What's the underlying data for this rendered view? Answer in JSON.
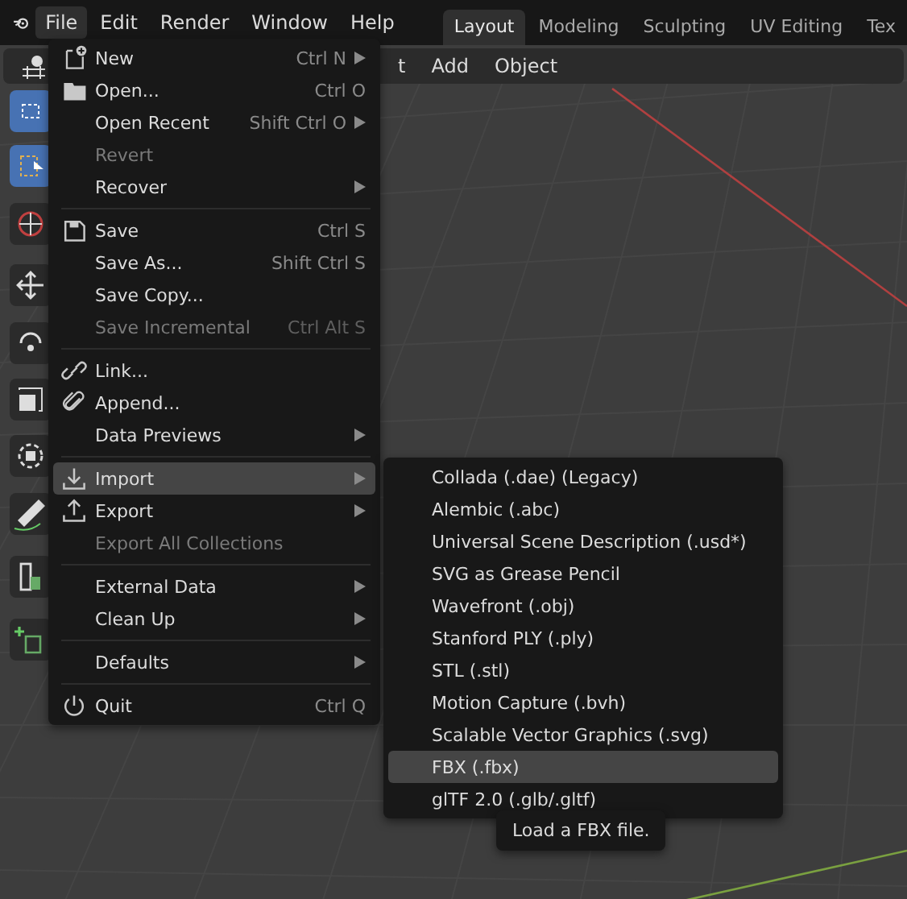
{
  "menu_bar": [
    {
      "label": "File",
      "selected": true
    },
    {
      "label": "Edit",
      "selected": false
    },
    {
      "label": "Render",
      "selected": false
    },
    {
      "label": "Window",
      "selected": false
    },
    {
      "label": "Help",
      "selected": false
    }
  ],
  "workspace_tabs": [
    {
      "label": "Layout",
      "selected": true
    },
    {
      "label": "Modeling",
      "selected": false
    },
    {
      "label": "Sculpting",
      "selected": false
    },
    {
      "label": "UV Editing",
      "selected": false
    },
    {
      "label": "Tex",
      "selected": false
    }
  ],
  "viewport_header": [
    "t",
    "Add",
    "Object"
  ],
  "toolbar": [
    {
      "selected": true
    },
    {
      "selected": true
    },
    {
      "selected": false
    },
    {
      "selected": false
    },
    {
      "selected": false
    },
    {
      "selected": false
    },
    {
      "selected": false
    },
    {
      "selected": false
    },
    {
      "selected": false
    },
    {
      "selected": false
    }
  ],
  "file_menu": [
    {
      "kind": "item",
      "label": "New",
      "shortcut": "Ctrl N",
      "submenu": true,
      "disabled": false,
      "selected": false
    },
    {
      "kind": "item",
      "label": "Open...",
      "shortcut": "Ctrl O",
      "submenu": false,
      "disabled": false,
      "selected": false
    },
    {
      "kind": "item",
      "label": "Open Recent",
      "shortcut": "Shift Ctrl O",
      "submenu": true,
      "disabled": false,
      "selected": false
    },
    {
      "kind": "item",
      "label": "Revert",
      "submenu": false,
      "disabled": true,
      "selected": false
    },
    {
      "kind": "item",
      "label": "Recover",
      "submenu": true,
      "disabled": false,
      "selected": false
    },
    {
      "kind": "separator"
    },
    {
      "kind": "item",
      "label": "Save",
      "shortcut": "Ctrl S",
      "submenu": false,
      "disabled": false,
      "selected": false
    },
    {
      "kind": "item",
      "label": "Save As...",
      "shortcut": "Shift Ctrl S",
      "submenu": false,
      "disabled": false,
      "selected": false
    },
    {
      "kind": "item",
      "label": "Save Copy...",
      "submenu": false,
      "disabled": false,
      "selected": false
    },
    {
      "kind": "item",
      "label": "Save Incremental",
      "shortcut": "Ctrl Alt S",
      "submenu": false,
      "disabled": true,
      "selected": false
    },
    {
      "kind": "separator"
    },
    {
      "kind": "item",
      "label": "Link...",
      "submenu": false,
      "disabled": false,
      "selected": false
    },
    {
      "kind": "item",
      "label": "Append...",
      "submenu": false,
      "disabled": false,
      "selected": false
    },
    {
      "kind": "item",
      "label": "Data Previews",
      "submenu": true,
      "disabled": false,
      "selected": false
    },
    {
      "kind": "separator"
    },
    {
      "kind": "item",
      "label": "Import",
      "submenu": true,
      "disabled": false,
      "selected": true
    },
    {
      "kind": "item",
      "label": "Export",
      "submenu": true,
      "disabled": false,
      "selected": false
    },
    {
      "kind": "item",
      "label": "Export All Collections",
      "submenu": false,
      "disabled": true,
      "selected": false
    },
    {
      "kind": "separator"
    },
    {
      "kind": "item",
      "label": "External Data",
      "submenu": true,
      "disabled": false,
      "selected": false
    },
    {
      "kind": "item",
      "label": "Clean Up",
      "submenu": true,
      "disabled": false,
      "selected": false
    },
    {
      "kind": "separator"
    },
    {
      "kind": "item",
      "label": "Defaults",
      "submenu": true,
      "disabled": false,
      "selected": false
    },
    {
      "kind": "separator"
    },
    {
      "kind": "item",
      "label": "Quit",
      "shortcut": "Ctrl Q",
      "submenu": false,
      "disabled": false,
      "selected": false
    }
  ],
  "import_menu": [
    {
      "label": "Collada (.dae) (Legacy)",
      "selected": false
    },
    {
      "label": "Alembic (.abc)",
      "selected": false
    },
    {
      "label": "Universal Scene Description (.usd*)",
      "selected": false
    },
    {
      "label": "SVG as Grease Pencil",
      "selected": false
    },
    {
      "label": "Wavefront (.obj)",
      "selected": false
    },
    {
      "label": "Stanford PLY (.ply)",
      "selected": false
    },
    {
      "label": "STL (.stl)",
      "selected": false
    },
    {
      "label": "Motion Capture (.bvh)",
      "selected": false
    },
    {
      "label": "Scalable Vector Graphics (.svg)",
      "selected": false
    },
    {
      "label": "FBX (.fbx)",
      "selected": true
    },
    {
      "label": "glTF 2.0 (.glb/.gltf)",
      "selected": false
    }
  ],
  "tooltip": "Load a FBX file."
}
